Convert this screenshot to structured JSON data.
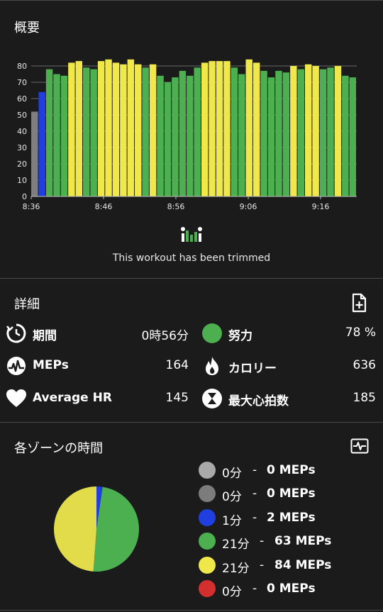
{
  "overview": {
    "title": "概要",
    "trimmed_text": "This workout has been trimmed"
  },
  "chart_data": {
    "type": "bar",
    "y_ticks": [
      0,
      10,
      20,
      30,
      40,
      50,
      60,
      70,
      80
    ],
    "ylim": [
      0,
      90
    ],
    "x_tick_labels": [
      "8:36",
      "8:46",
      "8:56",
      "9:06",
      "9:16"
    ],
    "zone_colors": {
      "gray": "#7f7f7f",
      "blue": "#1f3fe0",
      "green": "#4caf50",
      "yellow": "#f0e84a"
    },
    "bars": [
      {
        "v": 52,
        "z": "gray"
      },
      {
        "v": 64,
        "z": "blue"
      },
      {
        "v": 78,
        "z": "green"
      },
      {
        "v": 75,
        "z": "green"
      },
      {
        "v": 74,
        "z": "green"
      },
      {
        "v": 82,
        "z": "yellow"
      },
      {
        "v": 83,
        "z": "yellow"
      },
      {
        "v": 79,
        "z": "green"
      },
      {
        "v": 78,
        "z": "green"
      },
      {
        "v": 83,
        "z": "yellow"
      },
      {
        "v": 84,
        "z": "yellow"
      },
      {
        "v": 82,
        "z": "yellow"
      },
      {
        "v": 81,
        "z": "yellow"
      },
      {
        "v": 84,
        "z": "yellow"
      },
      {
        "v": 81,
        "z": "yellow"
      },
      {
        "v": 79,
        "z": "green"
      },
      {
        "v": 81,
        "z": "yellow"
      },
      {
        "v": 74,
        "z": "green"
      },
      {
        "v": 70,
        "z": "green"
      },
      {
        "v": 73,
        "z": "green"
      },
      {
        "v": 77,
        "z": "green"
      },
      {
        "v": 74,
        "z": "green"
      },
      {
        "v": 79,
        "z": "green"
      },
      {
        "v": 82,
        "z": "yellow"
      },
      {
        "v": 83,
        "z": "yellow"
      },
      {
        "v": 83,
        "z": "yellow"
      },
      {
        "v": 83,
        "z": "yellow"
      },
      {
        "v": 79,
        "z": "green"
      },
      {
        "v": 75,
        "z": "green"
      },
      {
        "v": 84,
        "z": "yellow"
      },
      {
        "v": 82,
        "z": "yellow"
      },
      {
        "v": 77,
        "z": "green"
      },
      {
        "v": 73,
        "z": "green"
      },
      {
        "v": 77,
        "z": "green"
      },
      {
        "v": 76,
        "z": "green"
      },
      {
        "v": 80,
        "z": "yellow"
      },
      {
        "v": 78,
        "z": "green"
      },
      {
        "v": 81,
        "z": "yellow"
      },
      {
        "v": 80,
        "z": "yellow"
      },
      {
        "v": 78,
        "z": "green"
      },
      {
        "v": 79,
        "z": "green"
      },
      {
        "v": 80,
        "z": "yellow"
      },
      {
        "v": 74,
        "z": "green"
      },
      {
        "v": 73,
        "z": "green"
      }
    ]
  },
  "details": {
    "title": "詳細",
    "stats": [
      {
        "label": "期間",
        "value": "0時56分",
        "icon": "timer-icon"
      },
      {
        "label": "努力",
        "value": "78 %",
        "icon": "effort-circle-icon"
      },
      {
        "label": "MEPs",
        "value": "164",
        "icon": "meps-icon"
      },
      {
        "label": "カロリー",
        "value": "636",
        "icon": "flame-icon"
      },
      {
        "label": "Average HR",
        "value": "145",
        "icon": "heart-icon"
      },
      {
        "label": "最大心拍数",
        "value": "185",
        "icon": "hourglass-icon"
      }
    ]
  },
  "zones": {
    "title": "各ゾーンの時間",
    "dash": "-",
    "items": [
      {
        "minutes": "0分",
        "meps": "0 MEPs",
        "color": "#a9a9a9"
      },
      {
        "minutes": "0分",
        "meps": "0 MEPs",
        "color": "#7c7c7c"
      },
      {
        "minutes": "1分",
        "meps": "2 MEPs",
        "color": "#1f3fe0"
      },
      {
        "minutes": "21分",
        "meps": "63 MEPs",
        "color": "#4caf50"
      },
      {
        "minutes": "21分",
        "meps": "84 MEPs",
        "color": "#f0e84a"
      },
      {
        "minutes": "0分",
        "meps": "0 MEPs",
        "color": "#d32f2f"
      }
    ],
    "pie": [
      {
        "name": "blue",
        "value": 1,
        "color": "#1f3fe0"
      },
      {
        "name": "green",
        "value": 21,
        "color": "#4caf50"
      },
      {
        "name": "yellow",
        "value": 21,
        "color": "#e2dc4b"
      }
    ]
  }
}
